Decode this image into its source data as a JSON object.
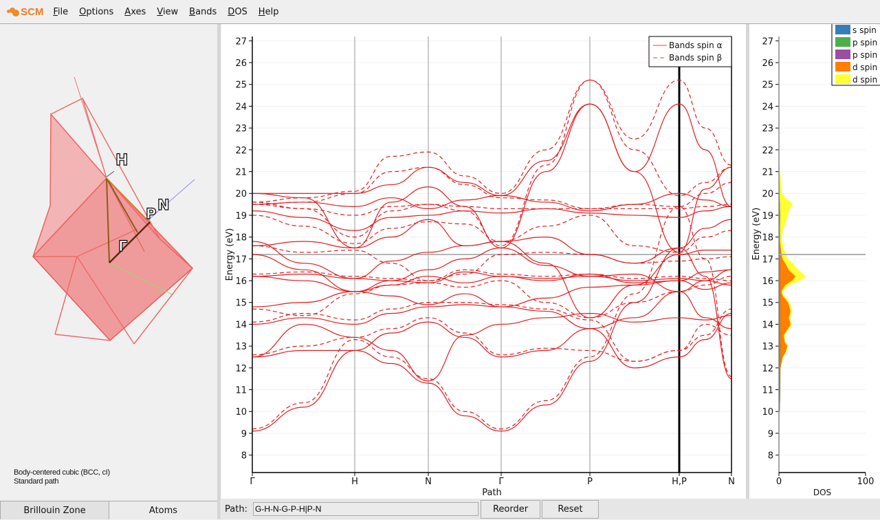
{
  "app": {
    "logo_text": "SCM",
    "menu": [
      {
        "label": "File",
        "accel": "F"
      },
      {
        "label": "Options",
        "accel": "O"
      },
      {
        "label": "Axes",
        "accel": "A"
      },
      {
        "label": "View",
        "accel": "V"
      },
      {
        "label": "Bands",
        "accel": "B"
      },
      {
        "label": "DOS",
        "accel": "D"
      },
      {
        "label": "Help",
        "accel": "H"
      }
    ]
  },
  "brillouin": {
    "labels": {
      "H": "H",
      "N": "N",
      "P": "P",
      "G": "Γ"
    },
    "caption_line1": "Body-centered cubic (BCC, cI)",
    "caption_line2": "Standard path",
    "tabs": [
      {
        "label": "Brillouin Zone",
        "active": true
      },
      {
        "label": "Atoms",
        "active": false
      }
    ]
  },
  "bottom_bar": {
    "path_label": "Path:",
    "path_value": "G-H-N-G-P-H|P-N",
    "reorder_label": "Reorder",
    "reset_label": "Reset"
  },
  "colors": {
    "band": "#e8191c",
    "s_spin": "#377eb8",
    "p_spin_a": "#4daf4a",
    "p_spin_b": "#984ea3",
    "d_spin_a": "#ff7f00",
    "d_spin_b": "#ffff33"
  },
  "chart_data": [
    {
      "type": "line",
      "title": "",
      "xlabel": "Path",
      "ylabel": "Energy (eV)",
      "ylim": [
        7.2,
        27.2
      ],
      "yticks": [
        8,
        9,
        10,
        11,
        12,
        13,
        14,
        15,
        16,
        17,
        18,
        19,
        20,
        21,
        22,
        23,
        24,
        25,
        26,
        27
      ],
      "fermi_level": 17.2,
      "kpoints": [
        {
          "label": "Γ",
          "x": 0
        },
        {
          "label": "H",
          "x": 149
        },
        {
          "label": "N",
          "x": 256
        },
        {
          "label": "Γ",
          "x": 362
        },
        {
          "label": "P",
          "x": 491
        },
        {
          "label": "H,P",
          "x": 621,
          "break": true
        },
        {
          "label": "N",
          "x": 697
        }
      ],
      "xlim": [
        0,
        697
      ],
      "legend": {
        "position": "top-right",
        "entries": [
          {
            "label": "Bands spin α",
            "style": "solid"
          },
          {
            "label": "Bands spin β",
            "style": "dashed"
          }
        ]
      },
      "sample_x": [
        0,
        75,
        149,
        202,
        256,
        309,
        362,
        427,
        491,
        556,
        621,
        659,
        697
      ],
      "series": [
        {
          "name": "alpha-1",
          "spin": "alpha",
          "values": [
            9.1,
            10.2,
            12.8,
            12.2,
            11.3,
            9.8,
            9.1,
            10.3,
            12.3,
            15.0,
            17.5,
            16.2,
            11.5
          ]
        },
        {
          "name": "beta-1",
          "spin": "beta",
          "values": [
            9.2,
            10.4,
            13.3,
            12.5,
            11.5,
            10.0,
            9.2,
            10.5,
            12.5,
            15.4,
            19.4,
            17.0,
            11.6
          ]
        },
        {
          "name": "alpha-2",
          "spin": "alpha",
          "values": [
            12.5,
            12.8,
            12.8,
            13.6,
            14.1,
            13.4,
            12.5,
            12.8,
            13.8,
            14.3,
            15.5,
            14.3,
            13.8
          ]
        },
        {
          "name": "beta-2",
          "spin": "beta",
          "values": [
            12.6,
            13.0,
            13.4,
            13.8,
            14.3,
            13.6,
            12.6,
            12.9,
            12.8,
            12.3,
            12.8,
            14.0,
            13.5
          ]
        },
        {
          "name": "alpha-3",
          "spin": "alpha",
          "values": [
            12.5,
            14.0,
            13.4,
            12.8,
            11.4,
            13.5,
            14.0,
            14.3,
            14.5,
            14.1,
            14.3,
            14.2,
            14.4
          ]
        },
        {
          "name": "alpha-4",
          "spin": "alpha",
          "values": [
            14.0,
            14.3,
            14.0,
            14.5,
            14.8,
            14.9,
            14.8,
            14.6,
            13.8,
            12.0,
            12.5,
            13.3,
            14.5
          ]
        },
        {
          "name": "beta-4",
          "spin": "beta",
          "values": [
            14.1,
            14.5,
            14.2,
            14.7,
            15.0,
            15.0,
            14.9,
            14.7,
            14.2,
            12.3,
            12.8,
            13.5,
            14.7
          ]
        },
        {
          "name": "alpha-5",
          "spin": "alpha",
          "values": [
            14.8,
            15.0,
            15.5,
            15.3,
            14.9,
            15.4,
            14.8,
            15.2,
            15.7,
            15.8,
            16.0,
            15.6,
            15.9
          ]
        },
        {
          "name": "beta-5",
          "spin": "beta",
          "values": [
            14.7,
            14.4,
            15.4,
            15.8,
            15.9,
            15.7,
            16.0,
            15.0,
            14.3,
            15.0,
            15.5,
            15.8,
            16.2
          ]
        },
        {
          "name": "alpha-6",
          "spin": "alpha",
          "values": [
            16.2,
            16.0,
            15.5,
            15.8,
            16.2,
            15.9,
            16.2,
            16.0,
            16.3,
            15.9,
            16.0,
            16.4,
            16.5
          ]
        },
        {
          "name": "alpha-7",
          "spin": "alpha",
          "values": [
            16.2,
            16.3,
            16.1,
            16.0,
            15.9,
            16.4,
            16.2,
            16.1,
            16.2,
            16.0,
            16.1,
            16.0,
            15.8
          ]
        },
        {
          "name": "beta-7",
          "spin": "beta",
          "values": [
            16.3,
            16.4,
            16.2,
            16.1,
            16.0,
            16.5,
            16.3,
            16.2,
            16.3,
            16.1,
            16.2,
            16.1,
            16.0
          ]
        },
        {
          "name": "alpha-8",
          "spin": "alpha",
          "values": [
            17.2,
            16.5,
            15.5,
            16.0,
            16.5,
            17.0,
            17.5,
            16.7,
            16.2,
            16.3,
            15.5,
            16.0,
            16.5
          ]
        },
        {
          "name": "alpha-9",
          "spin": "alpha",
          "values": [
            17.8,
            16.8,
            16.1,
            16.9,
            17.3,
            17.6,
            17.8,
            16.8,
            14.3,
            15.8,
            17.2,
            17.4,
            17.4
          ]
        },
        {
          "name": "beta-9",
          "spin": "beta",
          "values": [
            17.6,
            17.3,
            17.4,
            16.8,
            16.0,
            16.3,
            17.2,
            17.3,
            17.2,
            16.8,
            16.9,
            17.0,
            17.1
          ]
        },
        {
          "name": "alpha-10",
          "spin": "alpha",
          "values": [
            17.6,
            17.8,
            17.5,
            18.0,
            18.8,
            17.6,
            17.8,
            18.0,
            17.2,
            16.8,
            17.5,
            18.4,
            18.8
          ]
        },
        {
          "name": "beta-10",
          "spin": "beta",
          "values": [
            19.0,
            18.5,
            17.7,
            18.4,
            18.7,
            18.6,
            17.8,
            18.5,
            19.0,
            17.6,
            17.3,
            18.0,
            18.3
          ]
        },
        {
          "name": "alpha-11",
          "spin": "alpha",
          "values": [
            19.2,
            18.9,
            18.3,
            18.9,
            19.0,
            19.2,
            19.1,
            19.3,
            19.1,
            19.0,
            18.9,
            19.2,
            19.4
          ]
        },
        {
          "name": "beta-11",
          "spin": "beta",
          "values": [
            19.6,
            19.3,
            19.0,
            19.4,
            19.5,
            19.4,
            19.3,
            19.3,
            19.3,
            19.3,
            19.3,
            19.4,
            19.5
          ]
        },
        {
          "name": "alpha-12",
          "spin": "alpha",
          "values": [
            19.5,
            19.6,
            19.4,
            19.8,
            19.3,
            19.7,
            19.9,
            19.6,
            19.2,
            19.5,
            20.0,
            19.7,
            19.4
          ]
        },
        {
          "name": "beta-12",
          "spin": "beta",
          "values": [
            19.5,
            19.6,
            20.0,
            21.0,
            21.2,
            20.4,
            19.8,
            19.7,
            19.3,
            19.5,
            19.4,
            20.0,
            20.5
          ]
        },
        {
          "name": "alpha-13",
          "spin": "alpha",
          "values": [
            20.0,
            20.0,
            20.0,
            20.4,
            21.2,
            20.5,
            19.9,
            21.5,
            24.1,
            21.0,
            17.3,
            20.2,
            21.2
          ]
        },
        {
          "name": "beta-13",
          "spin": "beta",
          "values": [
            19.6,
            19.8,
            20.1,
            21.7,
            21.9,
            20.8,
            20.0,
            22.0,
            25.2,
            22.0,
            19.9,
            20.5,
            21.2
          ]
        },
        {
          "name": "alpha-14",
          "spin": "alpha",
          "values": [
            20.0,
            19.8,
            17.5,
            19.6,
            20.3,
            19.4,
            17.5,
            21.0,
            24.1,
            21.0,
            24.1,
            22.0,
            19.4
          ]
        },
        {
          "name": "beta-14",
          "spin": "beta",
          "values": [
            19.5,
            19.3,
            18.0,
            19.2,
            19.5,
            19.2,
            17.6,
            21.3,
            25.2,
            22.5,
            25.2,
            23.0,
            21.3
          ]
        }
      ]
    },
    {
      "type": "area",
      "title": "",
      "xlabel": "DOS",
      "ylabel": "Energy (eV)",
      "xlim": [
        0,
        100
      ],
      "xticks": [
        0,
        100
      ],
      "ylim": [
        7.2,
        27.2
      ],
      "yticks": [
        8,
        9,
        10,
        11,
        12,
        13,
        14,
        15,
        16,
        17,
        18,
        19,
        20,
        21,
        22,
        23,
        24,
        25,
        26,
        27
      ],
      "fermi_level": 17.2,
      "legend": {
        "position": "top-right",
        "entries": [
          {
            "label": "s spin",
            "color_key": "s_spin"
          },
          {
            "label": "p spin",
            "color_key": "p_spin_a"
          },
          {
            "label": "p spin",
            "color_key": "p_spin_b"
          },
          {
            "label": "d spin",
            "color_key": "d_spin_a"
          },
          {
            "label": "d spin",
            "color_key": "d_spin_b"
          }
        ]
      },
      "energies": [
        10.0,
        11.0,
        12.0,
        12.5,
        12.7,
        13.0,
        13.2,
        13.5,
        13.8,
        14.0,
        14.3,
        14.6,
        15.0,
        15.3,
        15.5,
        15.8,
        16.0,
        16.2,
        16.5,
        16.8,
        17.0,
        17.2,
        17.5,
        17.8,
        18.0,
        18.5,
        19.0,
        19.3,
        19.5,
        19.8,
        20.0,
        20.5,
        21.0,
        21.3
      ],
      "series": [
        {
          "name": "s spin",
          "color_key": "s_spin",
          "values": [
            0.5,
            0.8,
            0.6,
            0.7,
            0.8,
            0.8,
            0.7,
            0.7,
            0.6,
            0.6,
            0.6,
            0.6,
            0.6,
            0.6,
            0.5,
            0.5,
            0.5,
            0.5,
            0.5,
            0.5,
            0.5,
            0.4,
            0.4,
            0.4,
            0.4,
            0.3,
            0.3,
            0.3,
            0.3,
            0.3,
            0.3,
            0.2,
            0.2,
            0.1
          ]
        },
        {
          "name": "p spin α",
          "color_key": "p_spin_a",
          "values": [
            0.3,
            0.5,
            0.6,
            0.6,
            0.5,
            0.6,
            0.5,
            0.6,
            0.6,
            0.6,
            0.5,
            0.6,
            0.6,
            0.5,
            0.5,
            0.5,
            0.5,
            0.4,
            0.4,
            0.4,
            0.4,
            0.4,
            0.5,
            0.5,
            0.5,
            0.6,
            0.8,
            0.6,
            0.5,
            0.3,
            0.2,
            0.2,
            0.1,
            0.1
          ]
        },
        {
          "name": "p spin β",
          "color_key": "p_spin_b",
          "values": [
            0.2,
            0.3,
            0.3,
            0.3,
            0.3,
            0.3,
            0.3,
            0.3,
            0.3,
            0.3,
            0.3,
            0.3,
            0.3,
            0.3,
            0.3,
            0.3,
            0.3,
            0.3,
            0.3,
            0.3,
            0.3,
            0.3,
            0.3,
            0.3,
            0.3,
            0.3,
            0.3,
            0.3,
            0.3,
            0.2,
            0.2,
            0.1,
            0.1,
            0.0
          ]
        },
        {
          "name": "d spin α",
          "color_key": "d_spin_a",
          "values": [
            0.0,
            0.0,
            0.3,
            3.0,
            6.0,
            8.0,
            5.0,
            4.0,
            9.0,
            12.0,
            10.0,
            12.0,
            9.0,
            3.0,
            1.5,
            6.0,
            14.0,
            18.0,
            10.0,
            6.0,
            3.0,
            2.0,
            0.8,
            0.0,
            0.0,
            0.0,
            0.0,
            0.0,
            0.0,
            0.0,
            0.0,
            0.0,
            0.0,
            0.0
          ]
        },
        {
          "name": "d spin β",
          "color_key": "d_spin_b",
          "values": [
            0.0,
            0.0,
            0.0,
            0.5,
            0.5,
            1.0,
            1.0,
            1.0,
            1.5,
            1.5,
            1.5,
            2.0,
            2.0,
            2.0,
            1.0,
            5.0,
            9.0,
            12.0,
            11.0,
            9.0,
            6.0,
            5.0,
            3.0,
            3.0,
            2.0,
            5.0,
            9.0,
            11.0,
            15.0,
            7.0,
            3.0,
            2.0,
            1.0,
            0.5
          ]
        }
      ]
    }
  ]
}
